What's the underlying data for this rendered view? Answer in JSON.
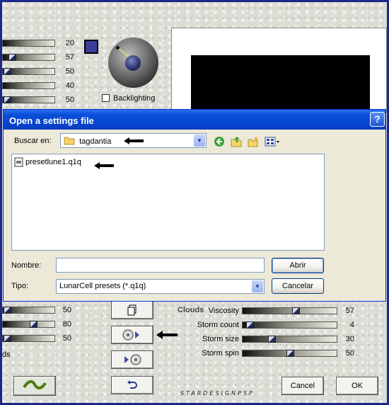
{
  "top_sliders": [
    {
      "value": "20",
      "pos": null
    },
    {
      "value": "57",
      "pos": 0.2
    },
    {
      "value": "50",
      "pos": 0.06
    },
    {
      "value": "40",
      "pos": null
    },
    {
      "value": "50",
      "pos": 0.06
    }
  ],
  "backlighting_label": "Backlighting",
  "bottom_left_sliders": [
    {
      "value": "50",
      "pos": 0.06
    },
    {
      "value": "80",
      "pos": 0.55
    },
    {
      "value": "50",
      "pos": 0.06
    }
  ],
  "partial_label": "ds",
  "clouds": {
    "title": "Clouds",
    "sliders": [
      {
        "label": "Viscosity",
        "value": "57",
        "pos": 0.57
      },
      {
        "label": "Storm count",
        "value": "4",
        "pos": 0.04
      },
      {
        "label": "Storm size",
        "value": "30",
        "pos": 0.29
      },
      {
        "label": "Storm spin",
        "value": "50",
        "pos": 0.49
      }
    ]
  },
  "wordmark": "STARDESIGNPSP",
  "footer": {
    "cancel_label": "Cancel",
    "ok_label": "OK"
  },
  "dialog": {
    "title": "Open a settings file",
    "help": "?",
    "look_in_label": "Buscar en:",
    "look_in_value": "tagdantia",
    "files": [
      {
        "name": "presetlune1.q1q",
        "icon": "file-icon"
      }
    ],
    "name_label": "Nombre:",
    "name_value": "",
    "type_label": "Tipo:",
    "type_value": "LunarCell presets (*.q1q)",
    "open_label": "Abrir",
    "cancel_label": "Cancelar"
  }
}
